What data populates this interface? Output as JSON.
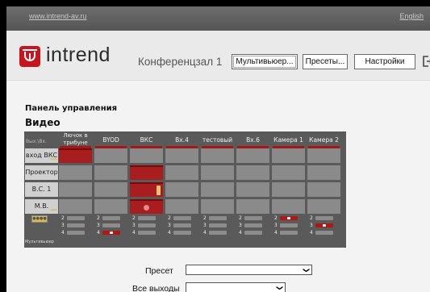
{
  "topbar": {
    "site_link": "www.intrend-av.ru",
    "lang_link": "English"
  },
  "header": {
    "logo_text": "intrend",
    "room_title": "Конференцзал 1",
    "buttons": {
      "multiviewer": "Мультивьюер...",
      "presets": "Пресеты...",
      "settings": "Настройки"
    },
    "exit_icon": "exit-icon"
  },
  "panel": {
    "title": "Панель управления",
    "video_title": "Видео"
  },
  "matrix": {
    "corner_label": "Вых.\\Вх.",
    "columns": [
      "Лючок в трибуне",
      "BYOD",
      "ВКС",
      "Вх.4",
      "тестовый",
      "Вх.6",
      "Камера 1",
      "Камера 2"
    ],
    "rows": [
      "вход ВКС",
      "Проектор",
      "В.С. 1",
      "М.В."
    ],
    "active": [
      [
        0,
        0
      ],
      [
        1,
        2
      ],
      [
        2,
        2
      ],
      [
        3,
        2
      ]
    ],
    "misc_button": "●●●●",
    "multiviewer_label": "Мультивьюер",
    "level_numbers": [
      "2",
      "3",
      "4"
    ],
    "colors": {
      "active": "#a81d1d",
      "cell": "#8a8a8a",
      "header_underline": "#a31818"
    }
  },
  "form": {
    "preset_label": "Пресет",
    "preset_value": "",
    "outputs_label": "Все выходы",
    "outputs_value": ""
  }
}
